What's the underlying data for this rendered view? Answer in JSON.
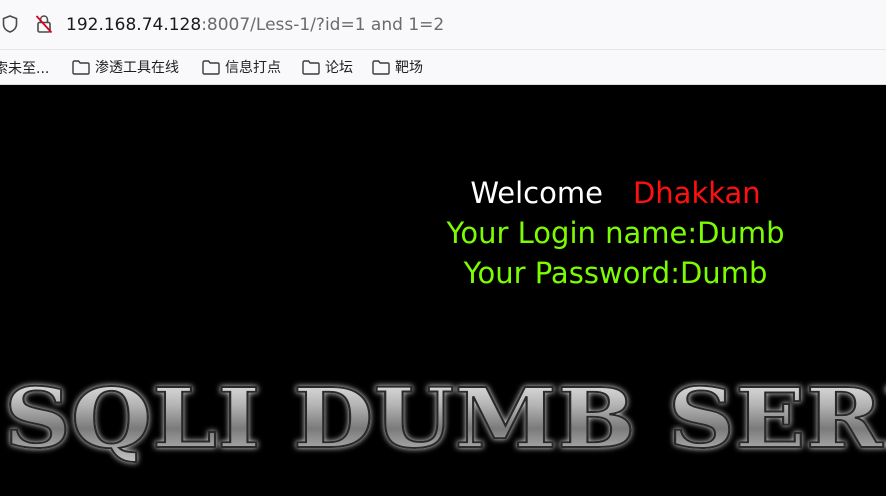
{
  "browser": {
    "url_host": "192.168.74.128",
    "url_rest": ":8007/Less-1/?id=1 and 1=2",
    "icons": [
      "shield-icon",
      "lock-warning-icon"
    ]
  },
  "bookmarks": {
    "items": [
      {
        "label": "索未至..."
      },
      {
        "label": "渗透工具在线"
      },
      {
        "label": "信息打点"
      },
      {
        "label": "论坛"
      },
      {
        "label": "靶场"
      }
    ]
  },
  "page": {
    "welcome_label": "Welcome",
    "welcome_name": "Dhakkan",
    "login_line": "Your Login name:Dumb",
    "password_line": "Your Password:Dumb",
    "banner_text": "SQLI DUMB SERIES",
    "colors": {
      "background": "#000000",
      "welcome": "#ffffff",
      "name": "#ff1010",
      "result": "#7CFC00"
    }
  }
}
